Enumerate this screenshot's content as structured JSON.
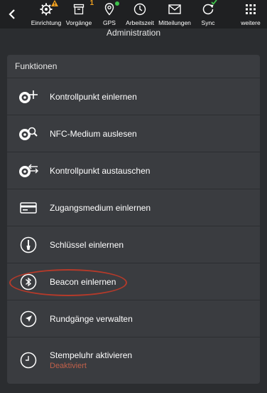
{
  "topbar": {
    "items": [
      {
        "label": "Einrichtung",
        "icon": "gear-icon"
      },
      {
        "label": "Vorgänge",
        "icon": "inbox-icon",
        "badge": "1"
      },
      {
        "label": "GPS",
        "icon": "location-pin-icon"
      },
      {
        "label": "Arbeitszeit",
        "icon": "clock-icon"
      },
      {
        "label": "Mitteilungen",
        "icon": "envelope-icon"
      },
      {
        "label": "Sync",
        "icon": "sync-icon"
      },
      {
        "label": "weitere",
        "icon": "grid-icon"
      }
    ]
  },
  "page": {
    "title": "Administration"
  },
  "panel": {
    "header": "Funktionen",
    "items": [
      {
        "label": "Kontrollpunkt einlernen",
        "icon": "checkpoint-add-icon"
      },
      {
        "label": "NFC-Medium auslesen",
        "icon": "nfc-read-icon"
      },
      {
        "label": "Kontrollpunkt austauschen",
        "icon": "checkpoint-exchange-icon"
      },
      {
        "label": "Zugangsmedium einlernen",
        "icon": "card-icon"
      },
      {
        "label": "Schlüssel einlernen",
        "icon": "key-icon"
      },
      {
        "label": "Beacon einlernen",
        "icon": "bluetooth-icon"
      },
      {
        "label": "Rundgänge verwalten",
        "icon": "navigation-arrow-icon"
      },
      {
        "label": "Stempeluhr aktivieren",
        "sublabel": "Deaktiviert",
        "icon": "clock-icon"
      }
    ]
  },
  "colors": {
    "background": "#2b2d30",
    "topbar": "#1f2022",
    "panel": "#3a3c40",
    "warning": "#f0a020",
    "gps_dot": "#3ec04a",
    "deactivated": "#c0604a",
    "highlight": "#b53a2a"
  }
}
